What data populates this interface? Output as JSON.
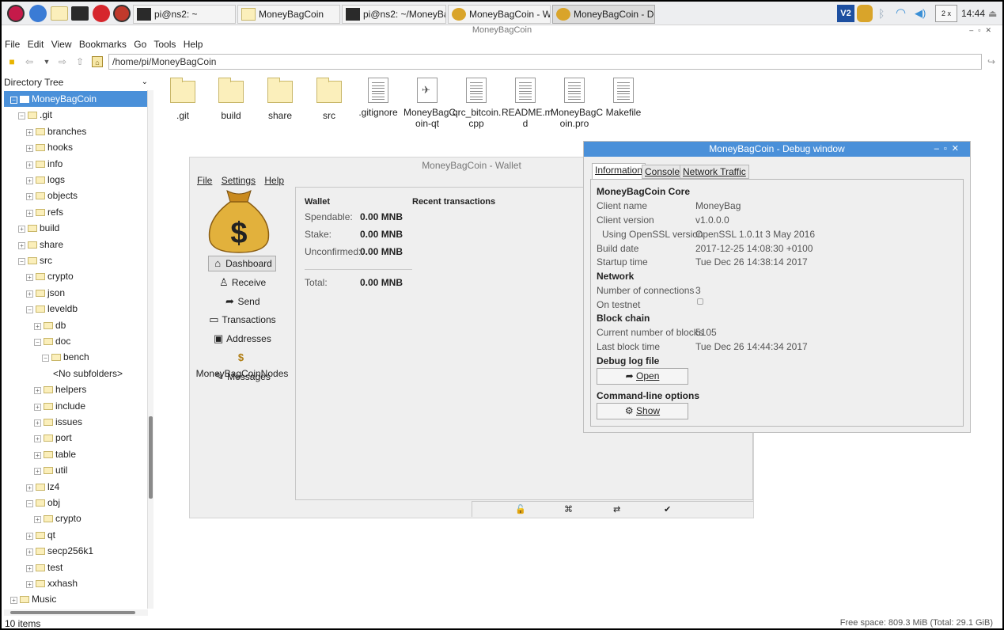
{
  "taskbar": {
    "tasks": [
      {
        "label": "pi@ns2: ~",
        "icon": "terminal-icon"
      },
      {
        "label": "MoneyBagCoin",
        "icon": "folder-icon"
      },
      {
        "label": "pi@ns2: ~/MoneyBa...",
        "icon": "terminal-icon"
      },
      {
        "label": "MoneyBagCoin - Wal...",
        "icon": "moneybag-icon"
      },
      {
        "label": "MoneyBagCoin - Deb...",
        "icon": "moneybag-icon"
      }
    ],
    "tray_workspace": "2 x",
    "clock": "14:44"
  },
  "window": {
    "title": "MoneyBagCoin"
  },
  "menubar": [
    "File",
    "Edit",
    "View",
    "Bookmarks",
    "Go",
    "Tools",
    "Help"
  ],
  "toolbar": {
    "path": "/home/pi/MoneyBagCoin"
  },
  "tree": {
    "header": "Directory Tree",
    "rows": [
      {
        "label": "MoneyBagCoin",
        "depth": 0,
        "exp": "−",
        "selected": true
      },
      {
        "label": ".git",
        "depth": 1,
        "exp": "−"
      },
      {
        "label": "branches",
        "depth": 2,
        "exp": "+"
      },
      {
        "label": "hooks",
        "depth": 2,
        "exp": "+"
      },
      {
        "label": "info",
        "depth": 2,
        "exp": "+"
      },
      {
        "label": "logs",
        "depth": 2,
        "exp": "+"
      },
      {
        "label": "objects",
        "depth": 2,
        "exp": "+"
      },
      {
        "label": "refs",
        "depth": 2,
        "exp": "+"
      },
      {
        "label": "build",
        "depth": 1,
        "exp": "+"
      },
      {
        "label": "share",
        "depth": 1,
        "exp": "+"
      },
      {
        "label": "src",
        "depth": 1,
        "exp": "−"
      },
      {
        "label": "crypto",
        "depth": 2,
        "exp": "+"
      },
      {
        "label": "json",
        "depth": 2,
        "exp": "+"
      },
      {
        "label": "leveldb",
        "depth": 2,
        "exp": "−"
      },
      {
        "label": "db",
        "depth": 3,
        "exp": "+"
      },
      {
        "label": "doc",
        "depth": 3,
        "exp": "−"
      },
      {
        "label": "bench",
        "depth": 4,
        "exp": "−"
      },
      {
        "label": "<No subfolders>",
        "depth": 5,
        "exp": ""
      },
      {
        "label": "helpers",
        "depth": 3,
        "exp": "+"
      },
      {
        "label": "include",
        "depth": 3,
        "exp": "+"
      },
      {
        "label": "issues",
        "depth": 3,
        "exp": "+"
      },
      {
        "label": "port",
        "depth": 3,
        "exp": "+"
      },
      {
        "label": "table",
        "depth": 3,
        "exp": "+"
      },
      {
        "label": "util",
        "depth": 3,
        "exp": "+"
      },
      {
        "label": "lz4",
        "depth": 2,
        "exp": "+"
      },
      {
        "label": "obj",
        "depth": 2,
        "exp": "−"
      },
      {
        "label": "crypto",
        "depth": 3,
        "exp": "+"
      },
      {
        "label": "qt",
        "depth": 2,
        "exp": "+"
      },
      {
        "label": "secp256k1",
        "depth": 2,
        "exp": "+"
      },
      {
        "label": "test",
        "depth": 2,
        "exp": "+"
      },
      {
        "label": "xxhash",
        "depth": 2,
        "exp": "+"
      },
      {
        "label": "Music",
        "depth": 0,
        "exp": "+"
      }
    ]
  },
  "files": [
    {
      "label": ".git",
      "type": "folder"
    },
    {
      "label": "build",
      "type": "folder"
    },
    {
      "label": "share",
      "type": "folder"
    },
    {
      "label": "src",
      "type": "folder"
    },
    {
      "label": ".gitignore",
      "type": "doc"
    },
    {
      "label": "MoneyBagC oin-qt",
      "type": "exec"
    },
    {
      "label": "qrc_bitcoin. cpp",
      "type": "doc"
    },
    {
      "label": "README.m d",
      "type": "doc"
    },
    {
      "label": "MoneyBagC oin.pro",
      "type": "doc"
    },
    {
      "label": "Makefile",
      "type": "doc"
    }
  ],
  "status": {
    "items": "10 items",
    "free_space": "Free space: 809.3 MiB (Total: 29.1 GiB)"
  },
  "wallet": {
    "title": "MoneyBagCoin - Wallet",
    "menu": [
      "File",
      "Settings",
      "Help"
    ],
    "nav": [
      {
        "label": "Dashboard",
        "icon": "home-icon",
        "active": true
      },
      {
        "label": "Receive",
        "icon": "receive-icon"
      },
      {
        "label": "Send",
        "icon": "send-icon"
      },
      {
        "label": "Transactions",
        "icon": "transactions-icon"
      },
      {
        "label": "Addresses",
        "icon": "addresses-icon"
      },
      {
        "label": "MoneyBagCoinNodes",
        "icon": "moneybag-icon"
      },
      {
        "label": "Messages",
        "icon": "pen-icon"
      }
    ],
    "panel": {
      "wallet_heading": "Wallet",
      "recent_heading": "Recent transactions",
      "spendable_label": "Spendable:",
      "spendable_value": "0.00 MNB",
      "stake_label": "Stake:",
      "stake_value": "0.00 MNB",
      "unconfirmed_label": "Unconfirmed:",
      "unconfirmed_value": "0.00 MNB",
      "total_label": "Total:",
      "total_value": "0.00 MNB"
    }
  },
  "debug": {
    "title": "MoneyBagCoin - Debug window",
    "tabs": [
      "Information",
      "Console",
      "Network Traffic"
    ],
    "core_heading": "MoneyBagCoin Core",
    "client_name_label": "Client name",
    "client_name": "MoneyBag",
    "client_version_label": "Client version",
    "client_version": "v1.0.0.0",
    "openssl_label": "Using OpenSSL version",
    "openssl": "OpenSSL 1.0.1t  3 May 2016",
    "build_date_label": "Build date",
    "build_date": "2017-12-25 14:08:30 +0100",
    "startup_label": "Startup time",
    "startup": "Tue Dec 26 14:38:14 2017",
    "network_heading": "Network",
    "connections_label": "Number of connections",
    "connections": "3",
    "testnet_label": "On testnet",
    "blockchain_heading": "Block chain",
    "blocks_label": "Current number of blocks",
    "blocks": "5105",
    "last_block_label": "Last block time",
    "last_block": "Tue Dec 26 14:44:34 2017",
    "debug_log_heading": "Debug log file",
    "open_button": "Open",
    "cmdline_heading": "Command-line options",
    "show_button": "Show"
  }
}
